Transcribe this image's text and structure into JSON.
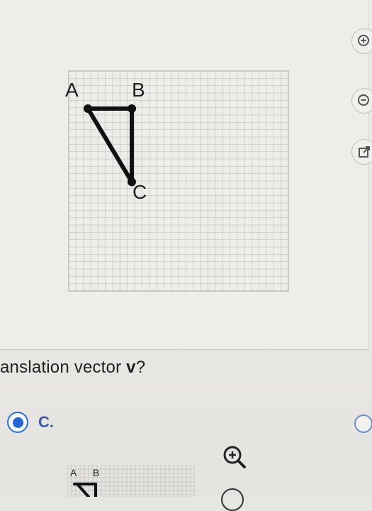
{
  "figure": {
    "labels": {
      "a": "A",
      "b": "B",
      "c": "C"
    },
    "points": {
      "a": [
        0,
        0
      ],
      "b": [
        6,
        0
      ],
      "c": [
        6,
        10
      ]
    },
    "grid": {
      "cols": 30,
      "rows": 30
    }
  },
  "side_buttons": [
    {
      "icon": "zoom-in-icon"
    },
    {
      "icon": "zoom-out-icon"
    },
    {
      "icon": "external-link-icon"
    }
  ],
  "question": {
    "prefix": "anslation vector ",
    "vector": "v",
    "suffix": "?"
  },
  "answer_option": {
    "label": "C.",
    "selected": true
  },
  "thumbnail": {
    "labels": {
      "a": "A",
      "b": "B"
    }
  },
  "colors": {
    "selected": "#2466d9",
    "line": "#111111",
    "grid": "#cfcfcc"
  }
}
